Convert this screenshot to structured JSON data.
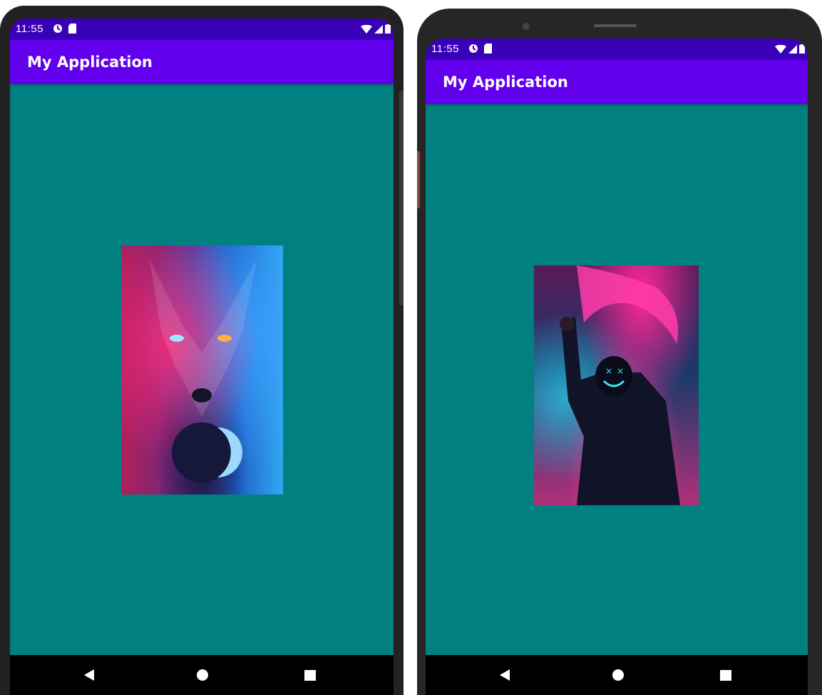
{
  "phones": [
    {
      "status": {
        "time": "11:55"
      },
      "app_bar": {
        "title": "My Application"
      },
      "content": {
        "image": "wolf-artwork"
      }
    },
    {
      "status": {
        "time": "11:55"
      },
      "app_bar": {
        "title": "My Application"
      },
      "content": {
        "image": "masked-figure-artwork"
      }
    }
  ],
  "colors": {
    "status_bar": "#3a00b8",
    "app_bar": "#6200ee",
    "screen_background": "#008080",
    "nav_bar": "#000000"
  },
  "icons": {
    "status_left": [
      "sync-icon",
      "sd-card-icon"
    ],
    "status_right": [
      "wifi-icon",
      "signal-icon",
      "battery-icon"
    ],
    "nav": [
      "back-icon",
      "home-icon",
      "recents-icon"
    ]
  }
}
